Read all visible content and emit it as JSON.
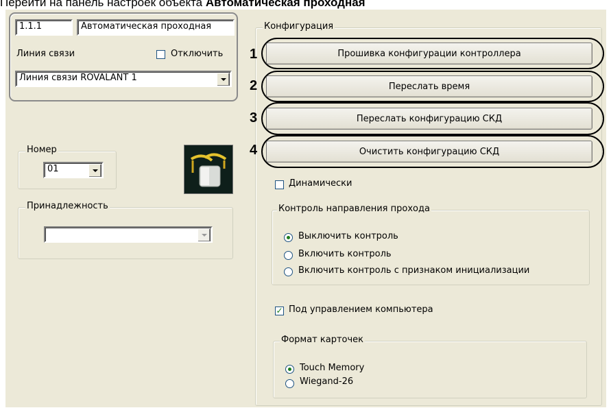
{
  "heading": {
    "prefix": "Перейти на панель настроек объекта ",
    "bold": "Автоматическая проходная"
  },
  "object": {
    "id": "1.1.1",
    "name": "Автоматическая проходная",
    "line_label": "Линия связи",
    "disable_label": "Отключить",
    "disable_checked": false,
    "line_value": "Линия связи ROVALANT 1"
  },
  "number": {
    "legend": "Номер",
    "value": "01"
  },
  "device_icon": "turnstile-icon",
  "belonging": {
    "legend": "Принадлежность",
    "value": ""
  },
  "config": {
    "legend": "Конфигурация",
    "buttons": [
      {
        "marker": "1",
        "label": "Прошивка конфигурации контроллера"
      },
      {
        "marker": "2",
        "label": "Переслать время"
      },
      {
        "marker": "3",
        "label": "Переслать конфигурацию СКД"
      },
      {
        "marker": "4",
        "label": "Очистить конфигурацию СКД"
      }
    ],
    "dynamic_label": "Динамически",
    "dynamic_checked": false,
    "direction": {
      "legend": "Контроль направления прохода",
      "options": [
        "Выключить контроль",
        "Включить контроль",
        "Включить контроль с признаком инициализации"
      ],
      "selected": 0
    },
    "pc_control_label": "Под управлением компьютера",
    "pc_control_checked": true,
    "card_format": {
      "legend": "Формат карточек",
      "options": [
        "Touch Memory",
        "Wiegand-26"
      ],
      "selected": 0
    }
  },
  "colors": {
    "panel": "#ece9d8",
    "annotation": "#000000",
    "radio_dot": "#1d7c1d"
  }
}
